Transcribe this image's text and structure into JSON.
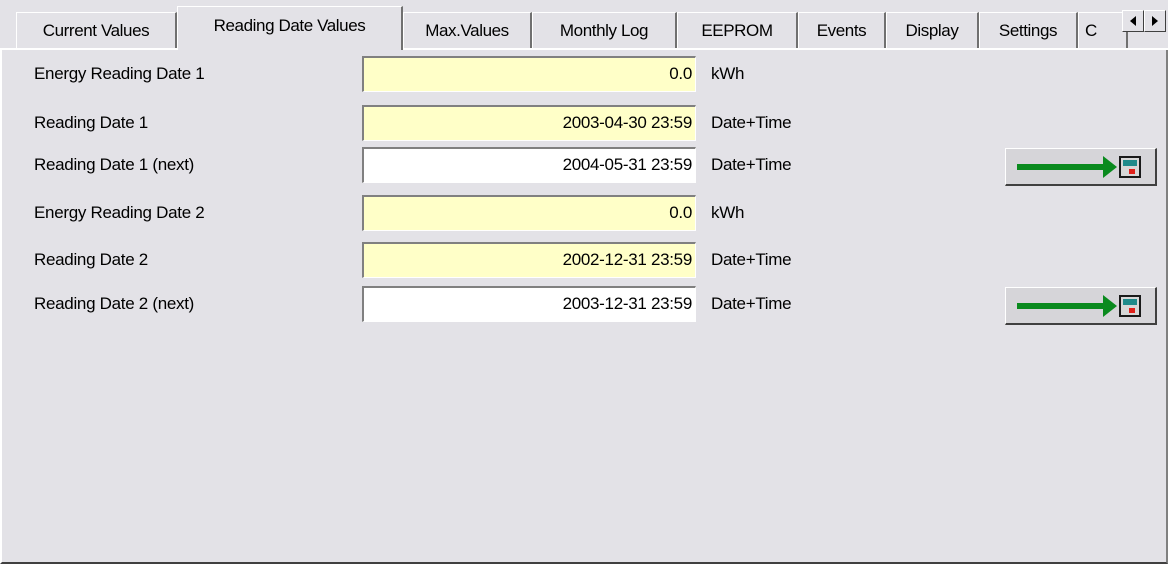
{
  "tabs": [
    {
      "label": "Current Values",
      "active": false
    },
    {
      "label": "Reading Date Values",
      "active": true
    },
    {
      "label": "Max.Values",
      "active": false
    },
    {
      "label": "Monthly Log",
      "active": false
    },
    {
      "label": "EEPROM",
      "active": false
    },
    {
      "label": "Events",
      "active": false
    },
    {
      "label": "Display",
      "active": false
    },
    {
      "label": "Settings",
      "active": false
    },
    {
      "label": "C",
      "active": false
    }
  ],
  "tab_scroll": {
    "left_icon": "triangle-left-icon",
    "right_icon": "triangle-right-icon"
  },
  "rows": [
    {
      "label": "Energy Reading Date 1",
      "value": "0.0",
      "unit": "kWh",
      "editable": false
    },
    {
      "label": "Reading Date 1",
      "value": "2003-04-30 23:59",
      "unit": "Date+Time",
      "editable": false
    },
    {
      "label": "Reading Date 1 (next)",
      "value": "2004-05-31 23:59",
      "unit": "Date+Time",
      "editable": true,
      "write_button_icon": "arrow-to-meter-icon"
    },
    {
      "label": "Energy Reading Date 2",
      "value": "0.0",
      "unit": "kWh",
      "editable": false
    },
    {
      "label": "Reading Date 2",
      "value": "2002-12-31 23:59",
      "unit": "Date+Time",
      "editable": false
    },
    {
      "label": "Reading Date 2 (next)",
      "value": "2003-12-31 23:59",
      "unit": "Date+Time",
      "editable": true,
      "write_button_icon": "arrow-to-meter-icon"
    }
  ],
  "colors": {
    "readonly_field": "#ffffc8",
    "editable_field": "#ffffff",
    "arrow": "#0a8a1e",
    "meter_screen": "#1f8a8a",
    "meter_button": "#e0201a"
  }
}
